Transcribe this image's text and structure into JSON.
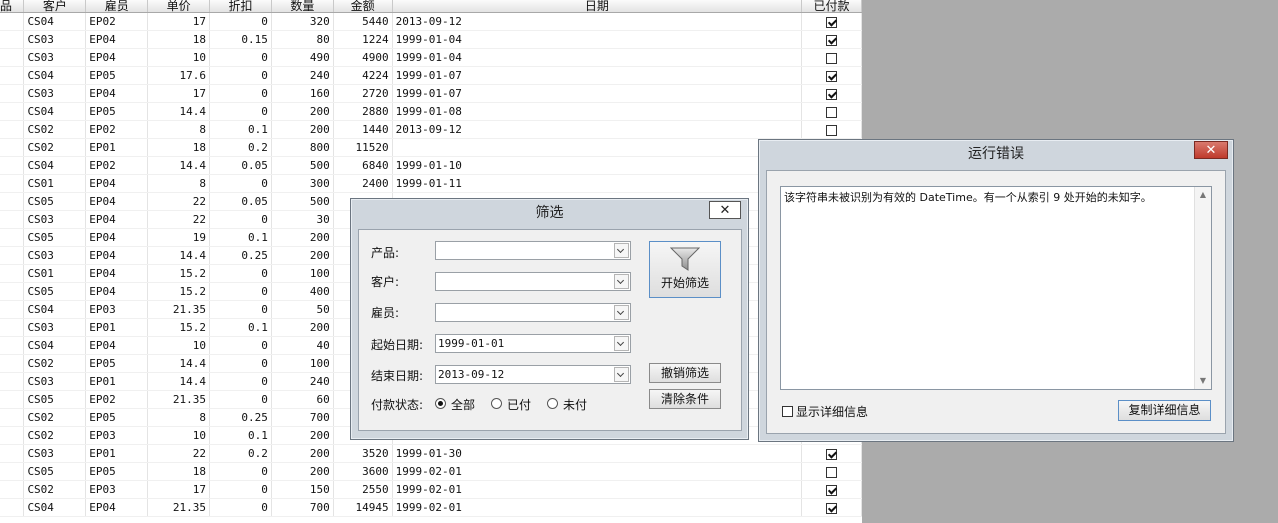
{
  "grid": {
    "headers": [
      "品",
      "客户",
      "雇员",
      "单价",
      "折扣",
      "数量",
      "金额",
      "日期",
      "已付款"
    ],
    "rows": [
      [
        "CS04",
        "EP02",
        "17",
        "0",
        "320",
        "5440",
        "2013-09-12",
        true
      ],
      [
        "CS03",
        "EP04",
        "18",
        "0.15",
        "80",
        "1224",
        "1999-01-04",
        true
      ],
      [
        "CS03",
        "EP04",
        "10",
        "0",
        "490",
        "4900",
        "1999-01-04",
        false
      ],
      [
        "CS04",
        "EP05",
        "17.6",
        "0",
        "240",
        "4224",
        "1999-01-07",
        true
      ],
      [
        "CS03",
        "EP04",
        "17",
        "0",
        "160",
        "2720",
        "1999-01-07",
        true
      ],
      [
        "CS04",
        "EP05",
        "14.4",
        "0",
        "200",
        "2880",
        "1999-01-08",
        false
      ],
      [
        "CS02",
        "EP02",
        "8",
        "0.1",
        "200",
        "1440",
        "2013-09-12",
        false
      ],
      [
        "CS02",
        "EP01",
        "18",
        "0.2",
        "800",
        "11520",
        "",
        null
      ],
      [
        "CS04",
        "EP02",
        "14.4",
        "0.05",
        "500",
        "6840",
        "1999-01-10",
        null
      ],
      [
        "CS01",
        "EP04",
        "8",
        "0",
        "300",
        "2400",
        "1999-01-11",
        null
      ],
      [
        "CS05",
        "EP04",
        "22",
        "0.05",
        "500",
        "",
        "",
        null
      ],
      [
        "CS03",
        "EP04",
        "22",
        "0",
        "30",
        "",
        "",
        null
      ],
      [
        "CS05",
        "EP04",
        "19",
        "0.1",
        "200",
        "",
        "",
        null
      ],
      [
        "CS03",
        "EP04",
        "14.4",
        "0.25",
        "200",
        "",
        "",
        null
      ],
      [
        "CS01",
        "EP04",
        "15.2",
        "0",
        "100",
        "",
        "",
        null
      ],
      [
        "CS05",
        "EP04",
        "15.2",
        "0",
        "400",
        "",
        "",
        null
      ],
      [
        "CS04",
        "EP03",
        "21.35",
        "0",
        "50",
        "",
        "",
        null
      ],
      [
        "CS03",
        "EP01",
        "15.2",
        "0.1",
        "200",
        "",
        "",
        null
      ],
      [
        "CS04",
        "EP04",
        "10",
        "0",
        "40",
        "",
        "",
        null
      ],
      [
        "CS02",
        "EP05",
        "14.4",
        "0",
        "100",
        "",
        "",
        null
      ],
      [
        "CS03",
        "EP01",
        "14.4",
        "0",
        "240",
        "",
        "",
        null
      ],
      [
        "CS05",
        "EP02",
        "21.35",
        "0",
        "60",
        "",
        "",
        null
      ],
      [
        "CS02",
        "EP05",
        "8",
        "0.25",
        "700",
        "",
        "",
        null
      ],
      [
        "CS02",
        "EP03",
        "10",
        "0.1",
        "200",
        "",
        "",
        null
      ],
      [
        "CS03",
        "EP01",
        "22",
        "0.2",
        "200",
        "3520",
        "1999-01-30",
        true
      ],
      [
        "CS05",
        "EP05",
        "18",
        "0",
        "200",
        "3600",
        "1999-02-01",
        false
      ],
      [
        "CS02",
        "EP03",
        "17",
        "0",
        "150",
        "2550",
        "1999-02-01",
        true
      ],
      [
        "CS04",
        "EP04",
        "21.35",
        "0",
        "700",
        "14945",
        "1999-02-01",
        true
      ]
    ]
  },
  "filter_dialog": {
    "title": "筛选",
    "close": "✕",
    "product_label": "产品:",
    "customer_label": "客户:",
    "employee_label": "雇员:",
    "start_label": "起始日期:",
    "start_value": "1999-01-01",
    "end_label": "结束日期:",
    "end_value": "2013-09-12",
    "pay_label": "付款状态:",
    "pay_all": "全部",
    "pay_paid": "已付",
    "pay_unpaid": "未付",
    "start_filter_btn": "开始筛选",
    "cancel_filter_btn": "撤销筛选",
    "clear_btn": "清除条件"
  },
  "error_dialog": {
    "title": "运行错误",
    "close": "✕",
    "message": "该字符串未被识别为有效的 DateTime。有一个从索引 9 处开始的未知字。",
    "show_details": "显示详细信息",
    "copy_details": "复制详细信息"
  }
}
